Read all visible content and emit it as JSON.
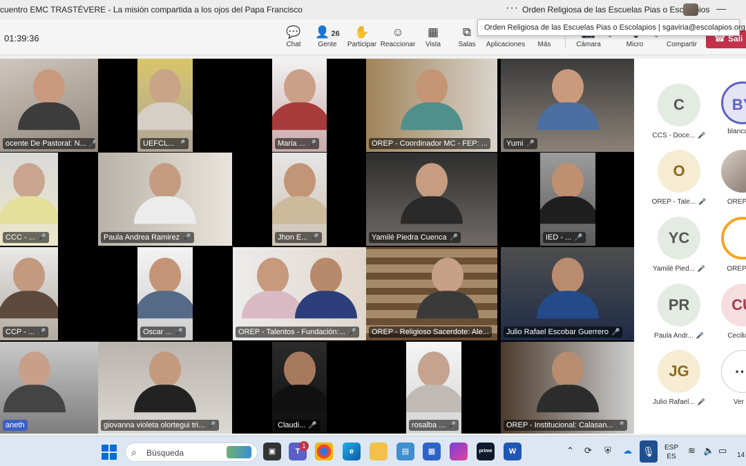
{
  "window": {
    "title": "cuentro EMC TRASTÉVERE - La misión compartida a los ojos del Papa Francisco",
    "more": "···",
    "org_name": "Orden Religiosa de las Escuelas Pias o Escolapios",
    "minimize": "—"
  },
  "tooltip": "Orden Religiosa de las Escuelas Pias o Escolapios | sgaviria@escolapios.org.co",
  "toolbar": {
    "timer": "01:39:36",
    "chat": "Chat",
    "people": "Gente",
    "people_count": "26",
    "raise": "Participar",
    "react": "Reaccionar",
    "view": "Vista",
    "rooms": "Salas",
    "apps": "Aplicaciones",
    "more": "Más",
    "camera": "Cámara",
    "mic": "Micro",
    "share": "Compartir",
    "leave": "Sali"
  },
  "tiles": [
    {
      "name": "ocente De Pastoral: N..."
    },
    {
      "name": "UEFCL..."
    },
    {
      "name": "Maria ..."
    },
    {
      "name": "OREP - Coordinador MC - FEP: ..."
    },
    {
      "name": "Yumi"
    },
    {
      "name": "CCC - ..."
    },
    {
      "name": "Paula  Andrea Ramirez"
    },
    {
      "name": "Jhon E..."
    },
    {
      "name": "Yamilé Piedra Cuenca"
    },
    {
      "name": "IED - ..."
    },
    {
      "name": "CCP - ..."
    },
    {
      "name": "Oscar ..."
    },
    {
      "name": "OREP - Talentos - Fundación:..."
    },
    {
      "name": "OREP - Religioso Sacerdote: Ale..."
    },
    {
      "name": "Julio Rafael Escobar Guerrero"
    },
    {
      "name": "aneth"
    },
    {
      "name": "giovanna violeta olortegui tri..."
    },
    {
      "name": "Claudi..."
    },
    {
      "name": "rosalba ..."
    },
    {
      "name": "OREP - Institucional: Calasan..."
    }
  ],
  "panel": [
    {
      "initials": "C",
      "name": "CCS - Doce...",
      "color": "#e3ebe3"
    },
    {
      "initials": "BY",
      "name": "blanca Ya",
      "color": "#e4e4f4"
    },
    {
      "initials": "O",
      "name": "OREP - Tale...",
      "color": "#f6ecd2"
    },
    {
      "initials": "",
      "name": "OREP - R",
      "color": "#d9cfc6"
    },
    {
      "initials": "YC",
      "name": "Yamilé Pied...",
      "color": "#e3ebe3"
    },
    {
      "initials": "",
      "name": "OREP - In",
      "color": "#f7a41d"
    },
    {
      "initials": "PR",
      "name": "Paula Andr...",
      "color": "#e3ebe3"
    },
    {
      "initials": "CU",
      "name": "Cecilia Ur",
      "color": "#f6dde0"
    },
    {
      "initials": "JG",
      "name": "Julio Rafael...",
      "color": "#f6ecd2"
    },
    {
      "initials": "···",
      "name": "Ver to",
      "color": "#ffffff"
    }
  ],
  "taskbar": {
    "search_text": "Búsqueda",
    "teams_badge": "1",
    "lang_top": "ESP",
    "lang_bottom": "ES",
    "clock": "14"
  },
  "colors": {
    "leave_red": "#c4314b",
    "accent_blue": "#0a6cd8"
  }
}
